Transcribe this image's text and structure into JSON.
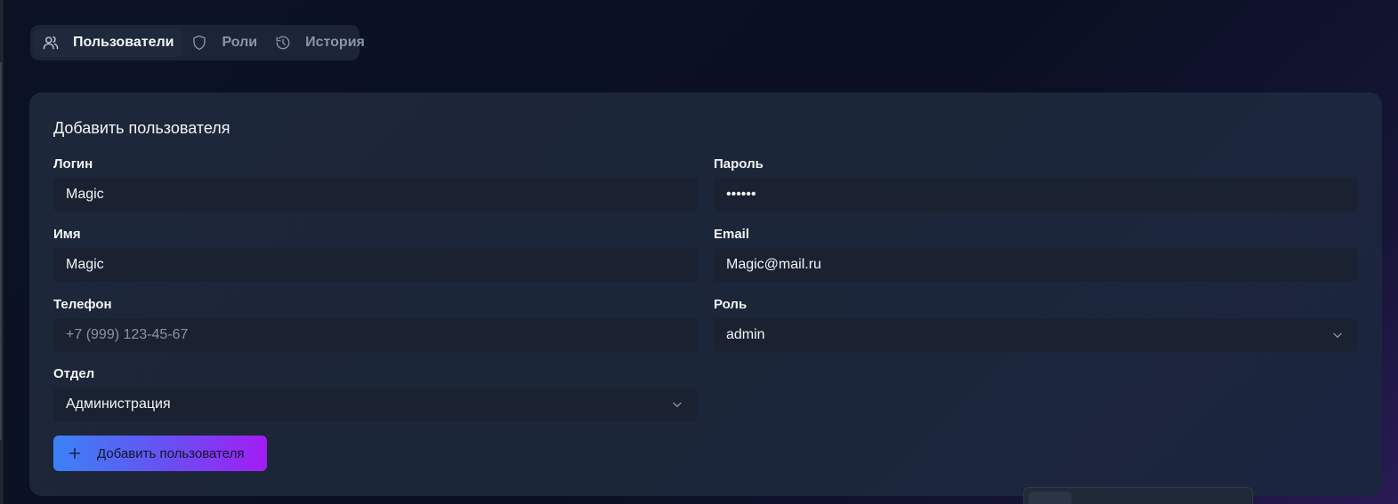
{
  "tabs": [
    {
      "label": "Пользователи",
      "icon": "users-icon",
      "active": true
    },
    {
      "label": "Роли",
      "icon": "shield-icon",
      "active": false
    },
    {
      "label": "История",
      "icon": "history-icon",
      "active": false
    }
  ],
  "form": {
    "title": "Добавить пользователя",
    "login": {
      "label": "Логин",
      "value": "Magic"
    },
    "password": {
      "label": "Пароль",
      "value": "••••••"
    },
    "name": {
      "label": "Имя",
      "value": "Magic"
    },
    "email": {
      "label": "Email",
      "value": "Magic@mail.ru"
    },
    "phone": {
      "label": "Телефон",
      "value": "",
      "placeholder": "+7 (999) 123-45-67"
    },
    "role": {
      "label": "Роль",
      "value": "admin"
    },
    "department": {
      "label": "Отдел",
      "value": "Администрация"
    },
    "submit_label": "Добавить пользователя"
  },
  "colors": {
    "accent_start": "#3b82f6",
    "accent_end": "#a21cf5",
    "background": "#0b1224",
    "card": "#1c2739"
  }
}
